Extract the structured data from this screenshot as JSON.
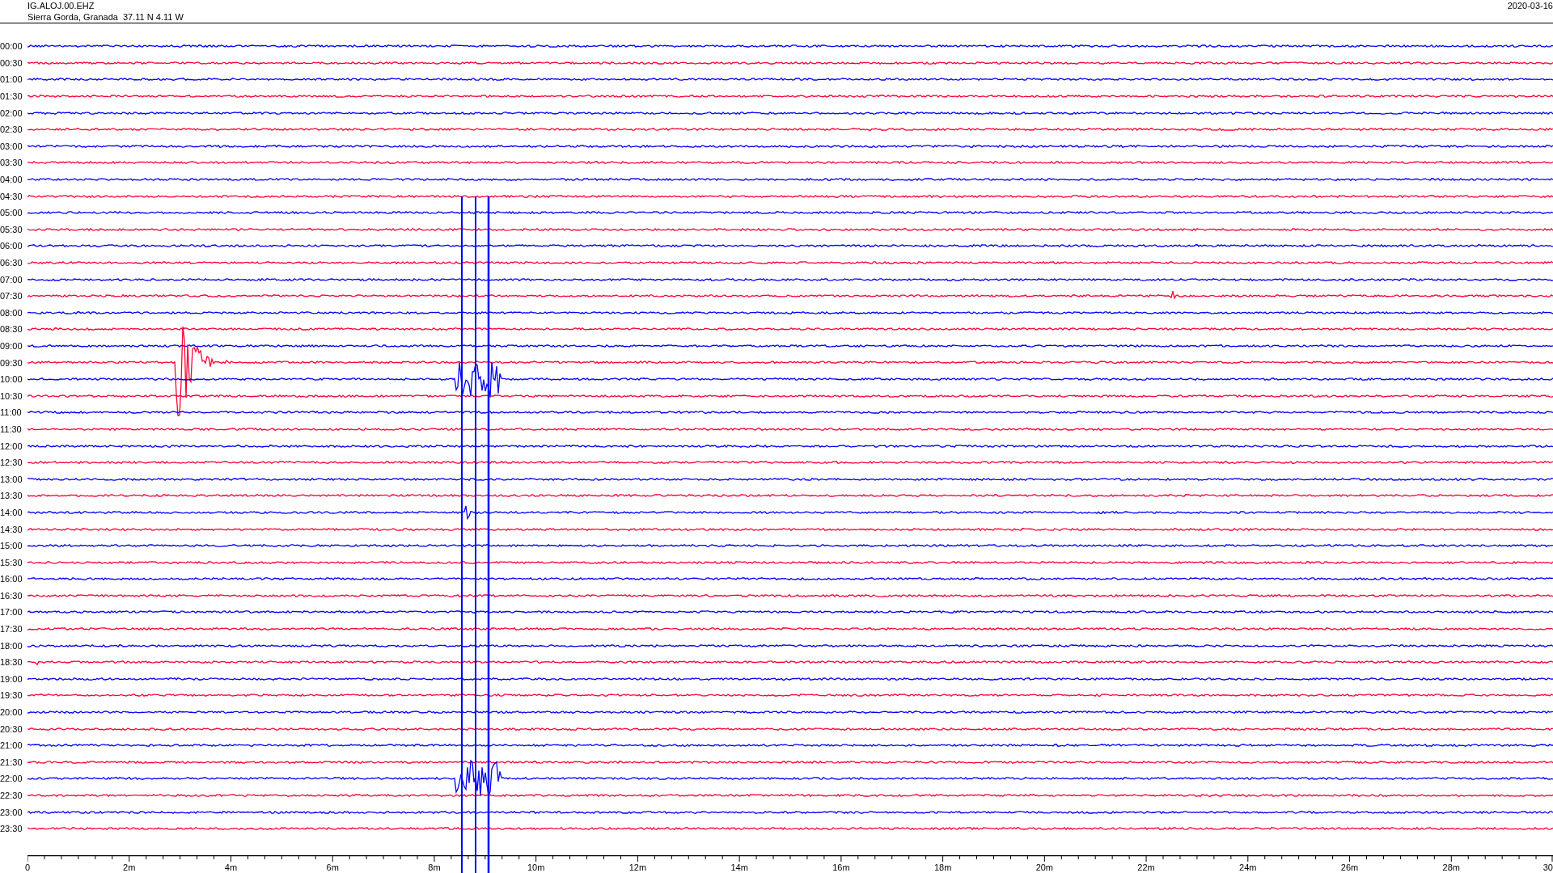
{
  "header": {
    "station": "IG.ALOJ.00.EHZ",
    "location": "Sierra Gorda, Granada  37.11 N 4.11 W",
    "date": "2020-03-16"
  },
  "rows": [
    {
      "time": "00:00",
      "color": "#0000ff"
    },
    {
      "time": "00:30",
      "color": "#ff0033"
    },
    {
      "time": "01:00",
      "color": "#0000ff"
    },
    {
      "time": "01:30",
      "color": "#ff0033"
    },
    {
      "time": "02:00",
      "color": "#0000ff"
    },
    {
      "time": "02:30",
      "color": "#ff0033"
    },
    {
      "time": "03:00",
      "color": "#0000ff"
    },
    {
      "time": "03:30",
      "color": "#ff0033"
    },
    {
      "time": "04:00",
      "color": "#0000ff"
    },
    {
      "time": "04:30",
      "color": "#ff0033"
    },
    {
      "time": "05:00",
      "color": "#0000ff"
    },
    {
      "time": "05:30",
      "color": "#ff0033"
    },
    {
      "time": "06:00",
      "color": "#0000ff"
    },
    {
      "time": "06:30",
      "color": "#ff0033"
    },
    {
      "time": "07:00",
      "color": "#0000ff"
    },
    {
      "time": "07:30",
      "color": "#ff0033"
    },
    {
      "time": "08:00",
      "color": "#0000ff"
    },
    {
      "time": "08:30",
      "color": "#ff0033"
    },
    {
      "time": "09:00",
      "color": "#0000ff"
    },
    {
      "time": "09:30",
      "color": "#ff0033"
    },
    {
      "time": "10:00",
      "color": "#0000ff"
    },
    {
      "time": "10:30",
      "color": "#ff0033"
    },
    {
      "time": "11:00",
      "color": "#0000ff"
    },
    {
      "time": "11:30",
      "color": "#ff0033"
    },
    {
      "time": "12:00",
      "color": "#0000ff"
    },
    {
      "time": "12:30",
      "color": "#ff0033"
    },
    {
      "time": "13:00",
      "color": "#0000ff"
    },
    {
      "time": "13:30",
      "color": "#ff0033"
    },
    {
      "time": "14:00",
      "color": "#0000ff"
    },
    {
      "time": "14:30",
      "color": "#ff0033"
    },
    {
      "time": "15:00",
      "color": "#0000ff"
    },
    {
      "time": "15:30",
      "color": "#ff0033"
    },
    {
      "time": "16:00",
      "color": "#0000ff"
    },
    {
      "time": "16:30",
      "color": "#ff0033"
    },
    {
      "time": "17:00",
      "color": "#0000ff"
    },
    {
      "time": "17:30",
      "color": "#ff0033"
    },
    {
      "time": "18:00",
      "color": "#0000ff"
    },
    {
      "time": "18:30",
      "color": "#ff0033"
    },
    {
      "time": "19:00",
      "color": "#0000ff"
    },
    {
      "time": "19:30",
      "color": "#ff0033"
    },
    {
      "time": "20:00",
      "color": "#0000ff"
    },
    {
      "time": "20:30",
      "color": "#ff0033"
    },
    {
      "time": "21:00",
      "color": "#0000ff"
    },
    {
      "time": "21:30",
      "color": "#ff0033"
    },
    {
      "time": "22:00",
      "color": "#0000ff"
    },
    {
      "time": "22:30",
      "color": "#ff0033"
    },
    {
      "time": "23:00",
      "color": "#0000ff"
    },
    {
      "time": "23:30",
      "color": "#ff0033"
    }
  ],
  "x_axis": {
    "ticks": [
      "0",
      "2m",
      "4m",
      "6m",
      "8m",
      "10m",
      "12m",
      "14m",
      "16m",
      "18m",
      "20m",
      "22m",
      "24m",
      "26m",
      "28m",
      "30"
    ]
  }
}
